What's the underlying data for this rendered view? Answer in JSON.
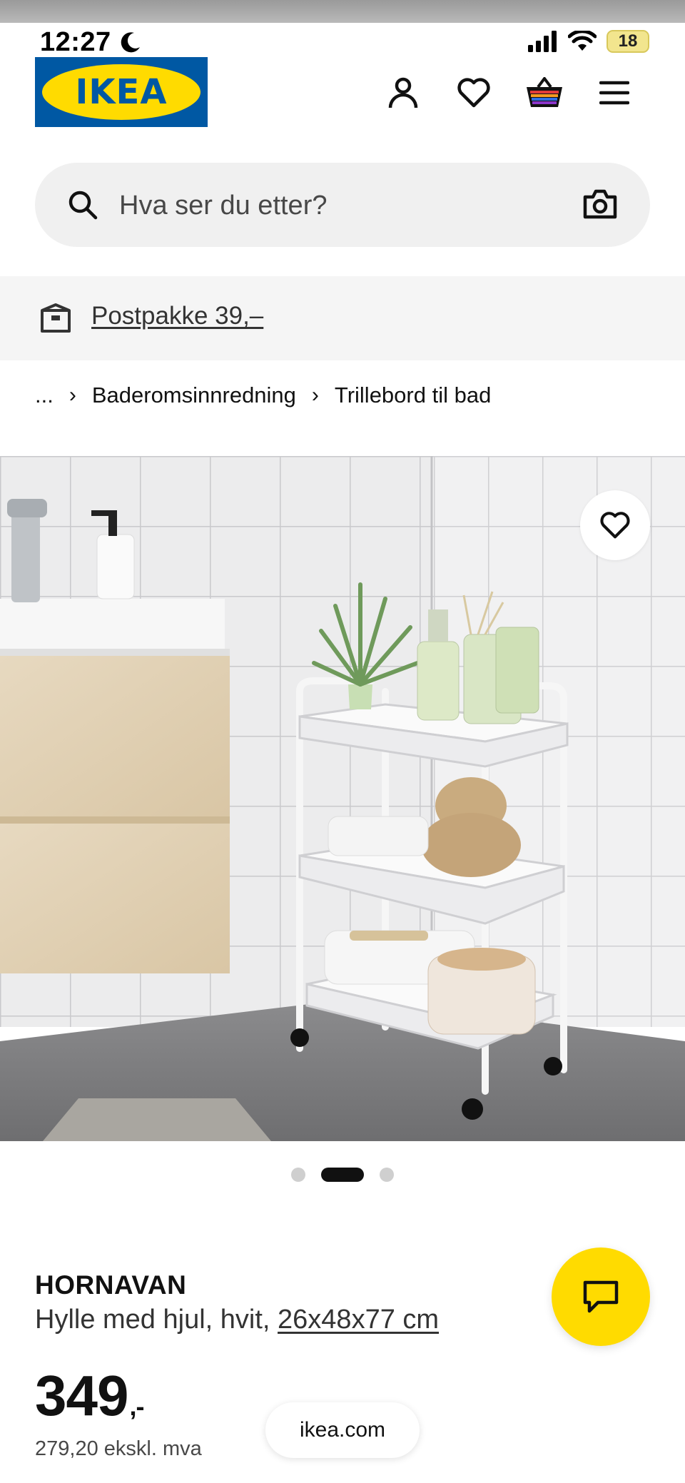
{
  "status_bar": {
    "time": "12:27",
    "battery": "18"
  },
  "header": {
    "logo_text": "IKEA",
    "icons": [
      "user-icon",
      "heart-icon",
      "cart-icon",
      "menu-icon"
    ]
  },
  "search": {
    "placeholder": "Hva ser du etter?"
  },
  "delivery": {
    "link_text": "Postpakke 39,–"
  },
  "breadcrumb": {
    "ellipsis": "...",
    "items": [
      "Baderomsinnredning",
      "Trillebord til bad"
    ]
  },
  "carousel": {
    "count": 3,
    "active_index": 1
  },
  "product": {
    "name": "HORNAVAN",
    "description": "Hylle med hjul, hvit,",
    "dimensions": "26x48x77 cm",
    "price": "349",
    "price_suffix": ",-",
    "price_ex_vat": "279,20 ekskl. mva"
  },
  "browser": {
    "url": "ikea.com"
  },
  "colors": {
    "ikea_blue": "#0058a3",
    "ikea_yellow": "#ffdb00"
  }
}
